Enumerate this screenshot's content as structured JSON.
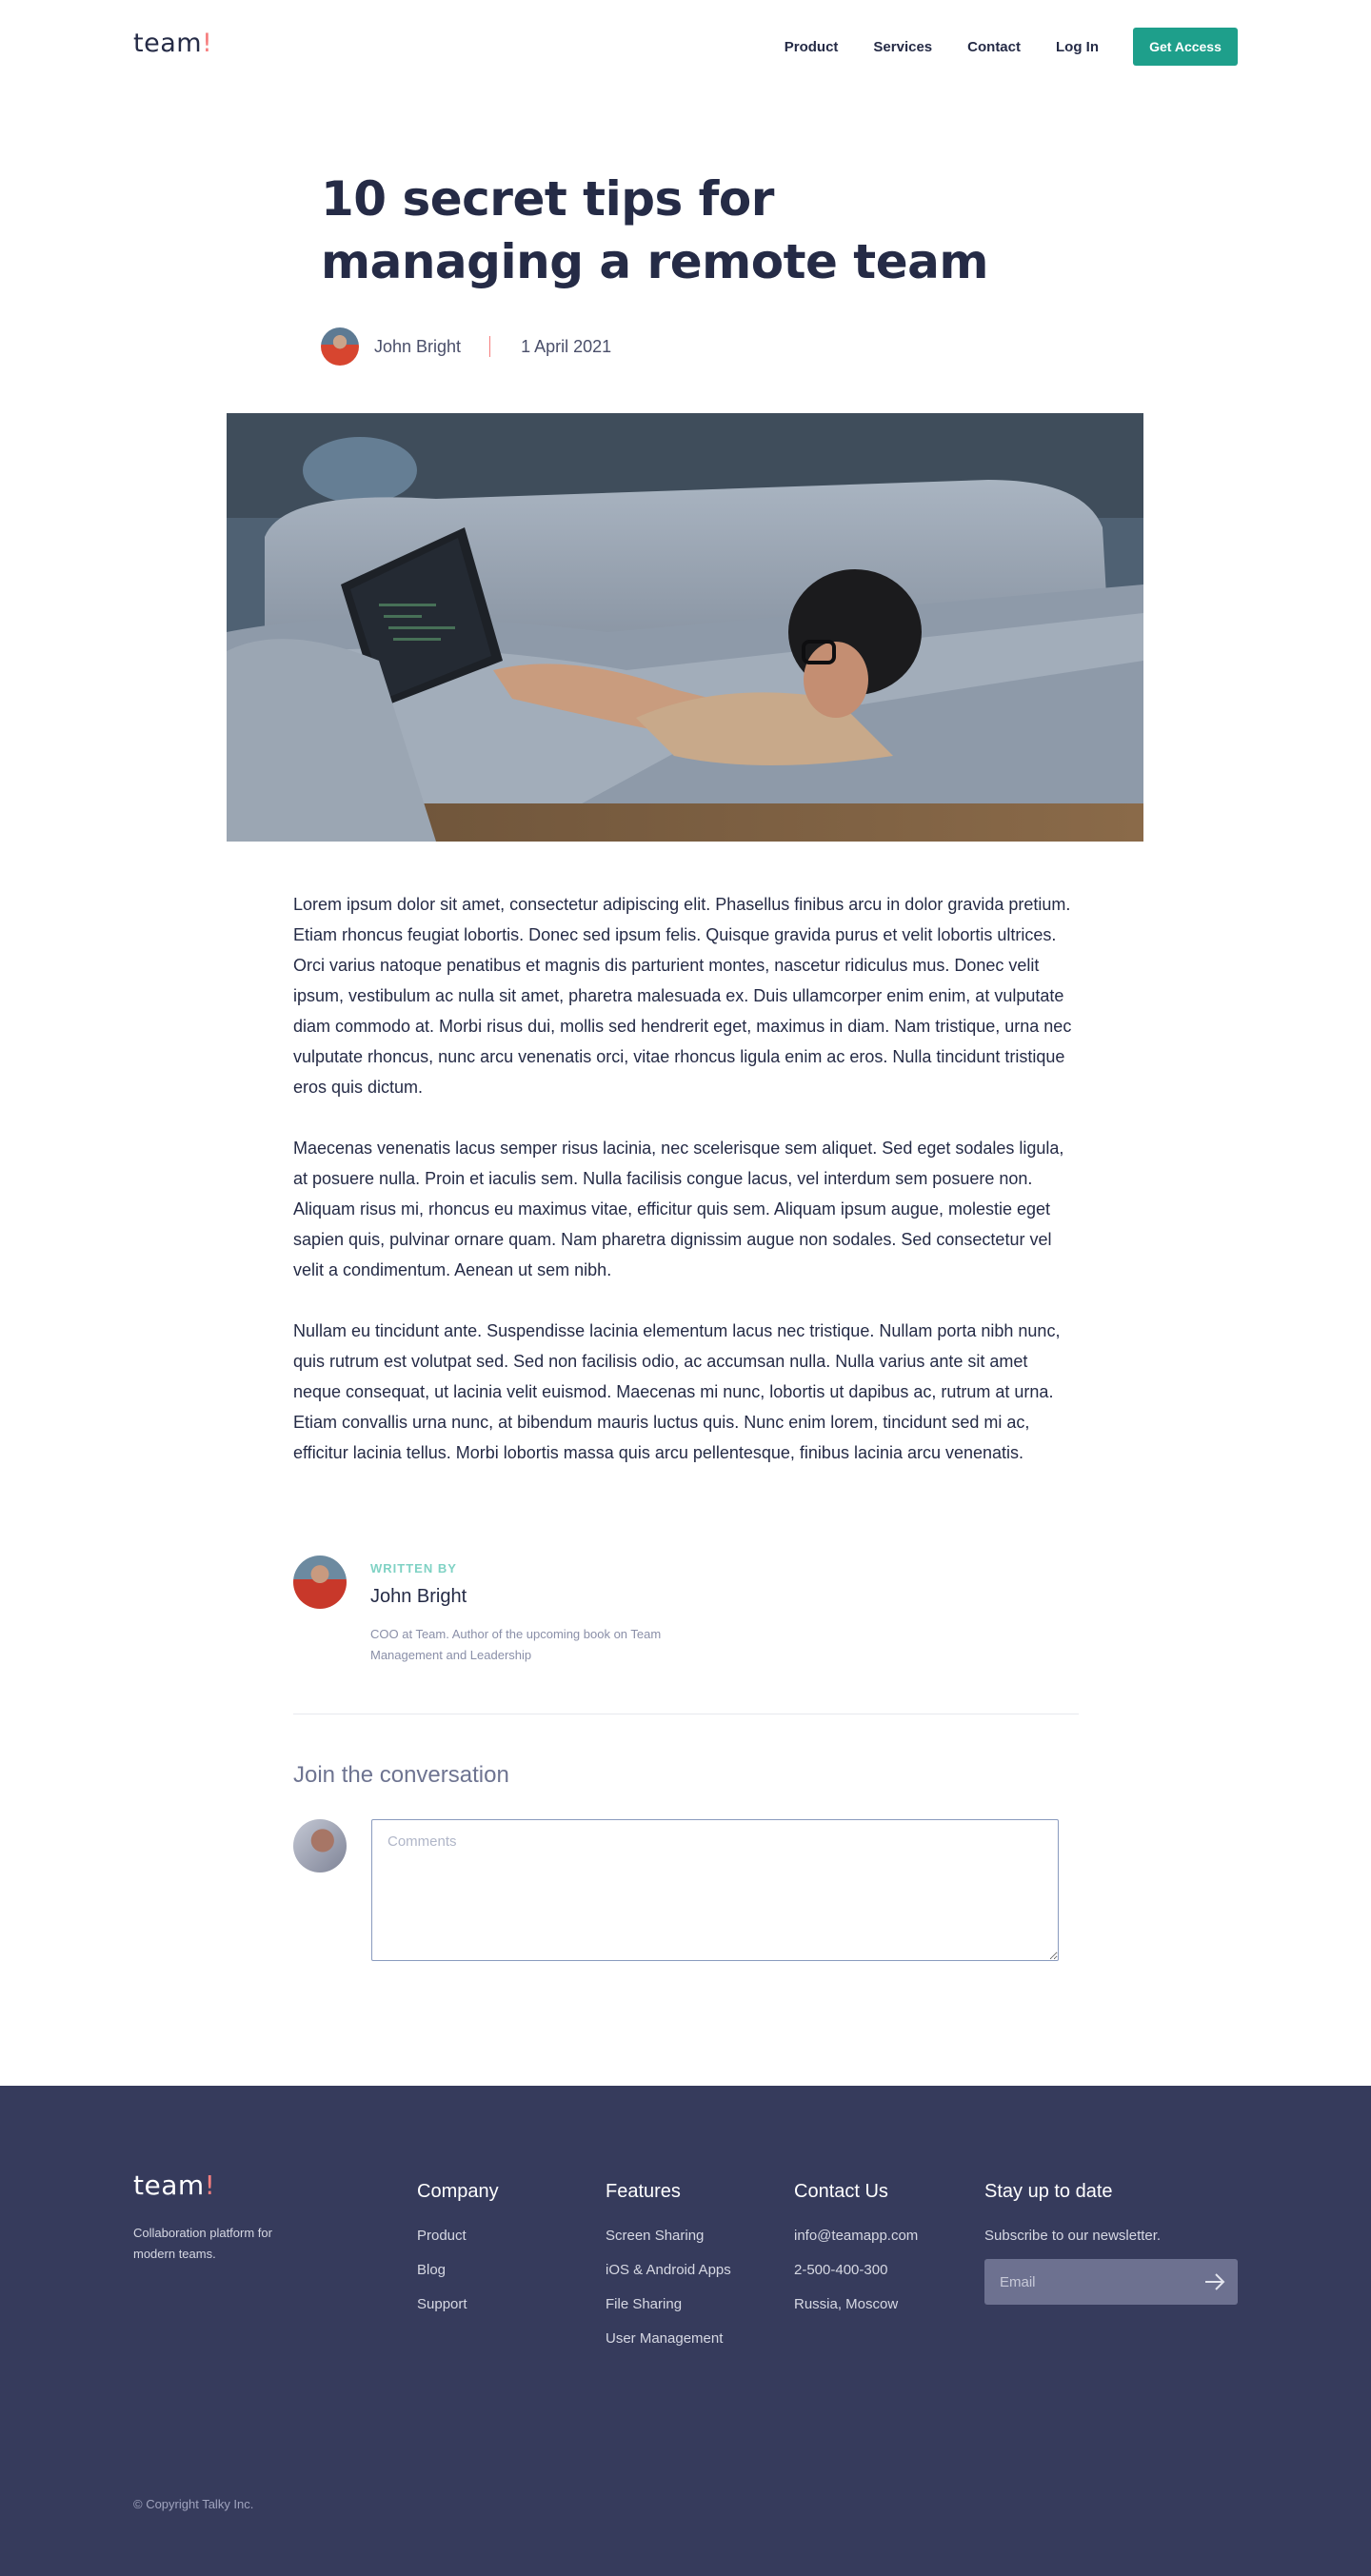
{
  "header": {
    "logo_text": "team",
    "logo_mark": "!",
    "nav": [
      "Product",
      "Services",
      "Contact",
      "Log In"
    ],
    "cta_label": "Get Access"
  },
  "article": {
    "title": "10 secret tips for managing a remote team",
    "author": "John Bright",
    "date": "1 April 2021",
    "paragraphs": [
      "Lorem ipsum dolor sit amet, consectetur adipiscing elit. Phasellus finibus arcu in dolor gravida pretium. Etiam rhoncus feugiat lobortis. Donec sed ipsum felis. Quisque gravida purus et velit lobortis ultrices. Orci varius natoque penatibus et magnis dis parturient montes, nascetur ridiculus mus. Donec velit ipsum, vestibulum ac nulla sit amet, pharetra malesuada ex. Duis ullamcorper enim enim, at vulputate diam commodo at. Morbi risus dui, mollis sed hendrerit eget, maximus in diam. Nam tristique, urna nec vulputate rhoncus, nunc arcu venenatis orci, vitae rhoncus ligula enim ac eros. Nulla tincidunt tristique eros quis dictum.",
      "Maecenas venenatis lacus semper risus lacinia, nec scelerisque sem aliquet. Sed eget sodales ligula, at posuere nulla. Proin et iaculis sem. Nulla facilisis congue lacus, vel interdum sem posuere non. Aliquam risus mi, rhoncus eu maximus vitae, efficitur quis sem. Aliquam ipsum augue, molestie eget sapien quis, pulvinar ornare quam. Nam pharetra dignissim augue non sodales. Sed consectetur vel velit a condimentum. Aenean ut sem nibh.",
      "Nullam eu tincidunt ante. Suspendisse lacinia elementum lacus nec tristique. Nullam porta nibh nunc, quis rutrum est volutpat sed. Sed non facilisis odio, ac accumsan nulla. Nulla varius ante sit amet neque consequat, ut lacinia velit euismod. Maecenas mi nunc, lobortis ut dapibus ac, rutrum at urna. Etiam convallis urna nunc, at bibendum mauris luctus quis. Nunc enim lorem, tincidunt sed mi ac, efficitur lacinia tellus. Morbi lobortis massa quis arcu pellentesque, finibus lacinia arcu venenatis."
    ]
  },
  "author_card": {
    "label": "WRITTEN BY",
    "name": "John Bright",
    "bio": "COO at Team. Author of the upcoming book on Team Management and Leadership"
  },
  "comments": {
    "title": "Join the conversation",
    "placeholder": "Comments"
  },
  "footer": {
    "logo_text": "team",
    "logo_mark": "!",
    "tagline": "Collaboration platform for modern teams.",
    "company": {
      "heading": "Company",
      "links": [
        "Product",
        "Blog",
        "Support"
      ]
    },
    "features": {
      "heading": "Features",
      "links": [
        "Screen Sharing",
        "iOS & Android Apps",
        "File Sharing",
        "User Management"
      ]
    },
    "contact": {
      "heading": "Contact Us",
      "items": [
        "info@teamapp.com",
        "2-500-400-300",
        "Russia, Moscow"
      ]
    },
    "newsletter": {
      "heading": "Stay up to date",
      "text": "Subscribe to our newsletter.",
      "placeholder": "Email"
    },
    "copyright": "© Copyright Talky Inc."
  },
  "colors": {
    "primary_dark": "#252b46",
    "accent_coral": "#f67e7e",
    "button_teal": "#1e9f8b",
    "footer_bg": "#363b5c",
    "label_mint": "#7fd2c4"
  },
  "icons": [
    "arrow-right-icon"
  ]
}
